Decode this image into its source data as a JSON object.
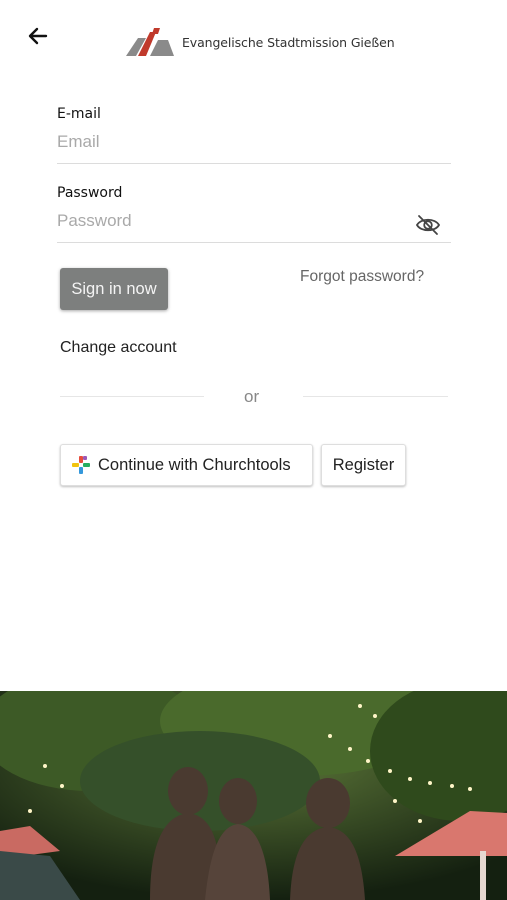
{
  "header": {
    "brand_name": "Evangelische Stadtmission Gießen"
  },
  "form": {
    "email": {
      "label": "E-mail",
      "placeholder": "Email",
      "value": ""
    },
    "password": {
      "label": "Password",
      "placeholder": "Password",
      "value": ""
    }
  },
  "actions": {
    "sign_in": "Sign in now",
    "forgot": "Forgot password?",
    "change_account": "Change account",
    "divider": "or",
    "churchtools": "Continue with Churchtools",
    "register": "Register"
  },
  "colors": {
    "primary_button": "#7d7f7e",
    "logo_red": "#c0392b",
    "logo_gray": "#8a8a8a"
  },
  "icons": {
    "back": "arrow-left-icon",
    "visibility": "eye-off-icon",
    "churchtools": "churchtools-cross-icon"
  }
}
